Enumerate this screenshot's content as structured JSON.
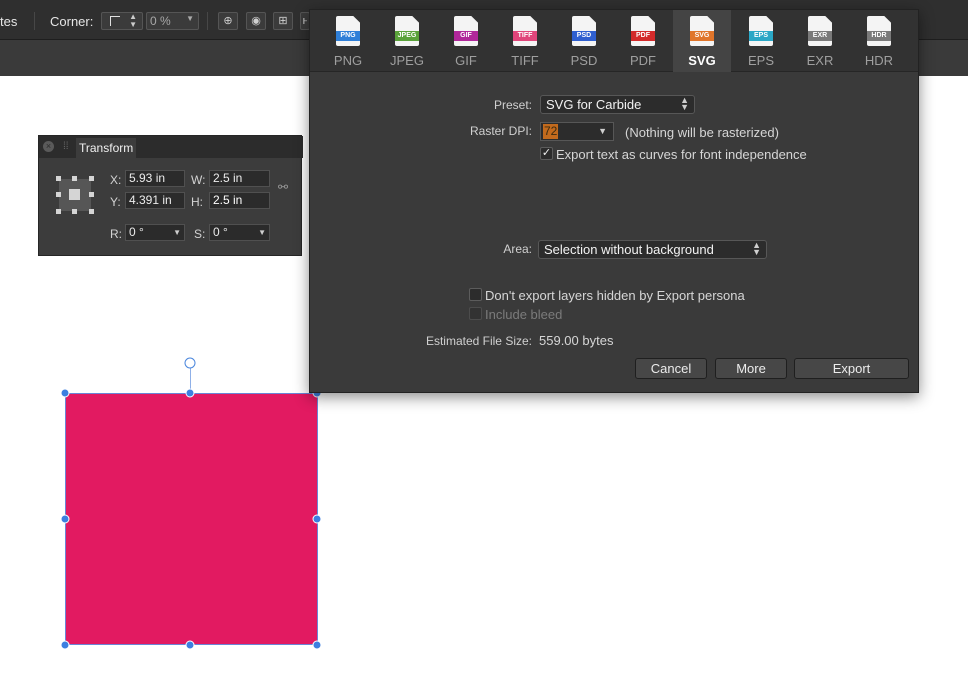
{
  "toolbar": {
    "cut_label": "tes",
    "corner_label": "Corner:",
    "corner_value": "0 %"
  },
  "transform_panel": {
    "title": "Transform",
    "x_label": "X:",
    "x_value": "5.93 in",
    "y_label": "Y:",
    "y_value": "4.391 in",
    "w_label": "W:",
    "w_value": "2.5 in",
    "h_label": "H:",
    "h_value": "2.5 in",
    "r_label": "R:",
    "r_value": "0 °",
    "s_label": "S:",
    "s_value": "0 °"
  },
  "shape": {
    "fill": "#e21a61"
  },
  "export": {
    "formats": [
      {
        "label": "PNG",
        "color": "#2f7fd8"
      },
      {
        "label": "JPEG",
        "color": "#5aa23a"
      },
      {
        "label": "GIF",
        "color": "#b0279a"
      },
      {
        "label": "TIFF",
        "color": "#e0457a"
      },
      {
        "label": "PSD",
        "color": "#2f5fcf"
      },
      {
        "label": "PDF",
        "color": "#d32a2a"
      },
      {
        "label": "SVG",
        "color": "#e0752a"
      },
      {
        "label": "EPS",
        "color": "#2aa7c6"
      },
      {
        "label": "EXR",
        "color": "#7a7a7a"
      },
      {
        "label": "HDR",
        "color": "#7a7a7a"
      }
    ],
    "selected_format": "SVG",
    "preset_label": "Preset:",
    "preset_value": "SVG for Carbide",
    "dpi_label": "Raster DPI:",
    "dpi_value": "72",
    "dpi_note": "(Nothing will be rasterized)",
    "curves_label": "Export text as curves for font independence",
    "curves_checked": true,
    "area_label": "Area:",
    "area_value": "Selection without background",
    "hidden_layers_label": "Don't export layers hidden by Export persona",
    "bleed_label": "Include bleed",
    "size_label": "Estimated File Size:",
    "size_value": "559.00 bytes",
    "cancel_label": "Cancel",
    "more_label": "More",
    "export_label": "Export"
  }
}
